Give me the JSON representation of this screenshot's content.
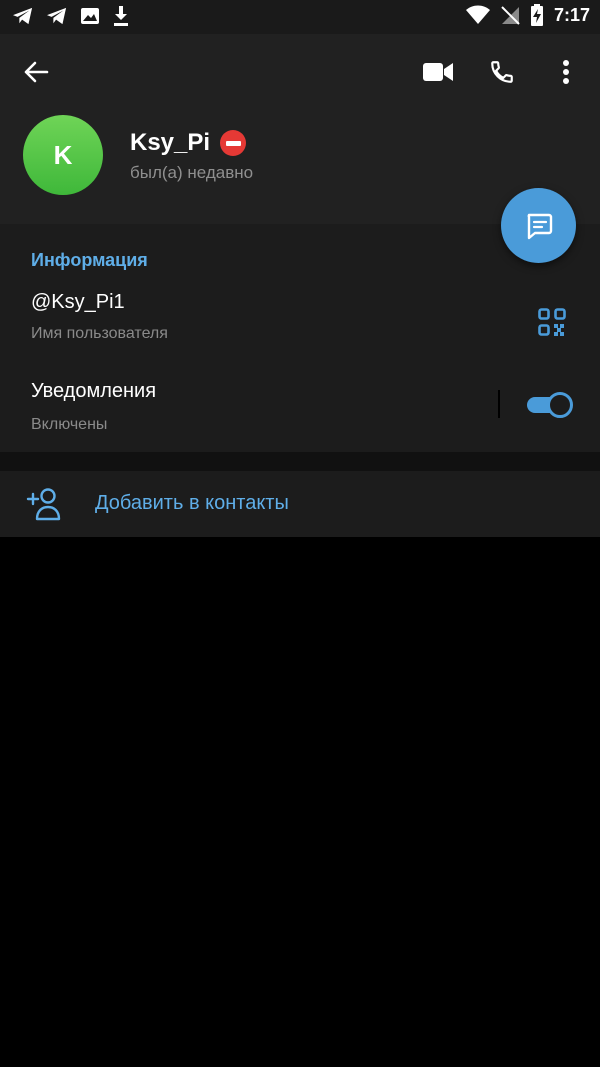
{
  "status_bar": {
    "time": "7:17",
    "left_icons": [
      "telegram-icon",
      "telegram-icon",
      "image-icon",
      "download-icon"
    ],
    "right_icons": [
      "wifi-icon",
      "no-sim-icon",
      "battery-charging-icon"
    ]
  },
  "profile": {
    "avatar_letter": "K",
    "name": "Ksy_Pi",
    "status": "был(а) недавно",
    "avatar_color": "#4cc04a"
  },
  "info": {
    "section_title": "Информация",
    "username_value": "@Ksy_Pi1",
    "username_label": "Имя пользователя",
    "notifications_label": "Уведомления",
    "notifications_status": "Включены",
    "notifications_enabled": true
  },
  "actions": {
    "add_contact_label": "Добавить в контакты"
  },
  "colors": {
    "accent": "#4a9bd9",
    "link": "#5faee8",
    "blocked": "#e53935"
  }
}
